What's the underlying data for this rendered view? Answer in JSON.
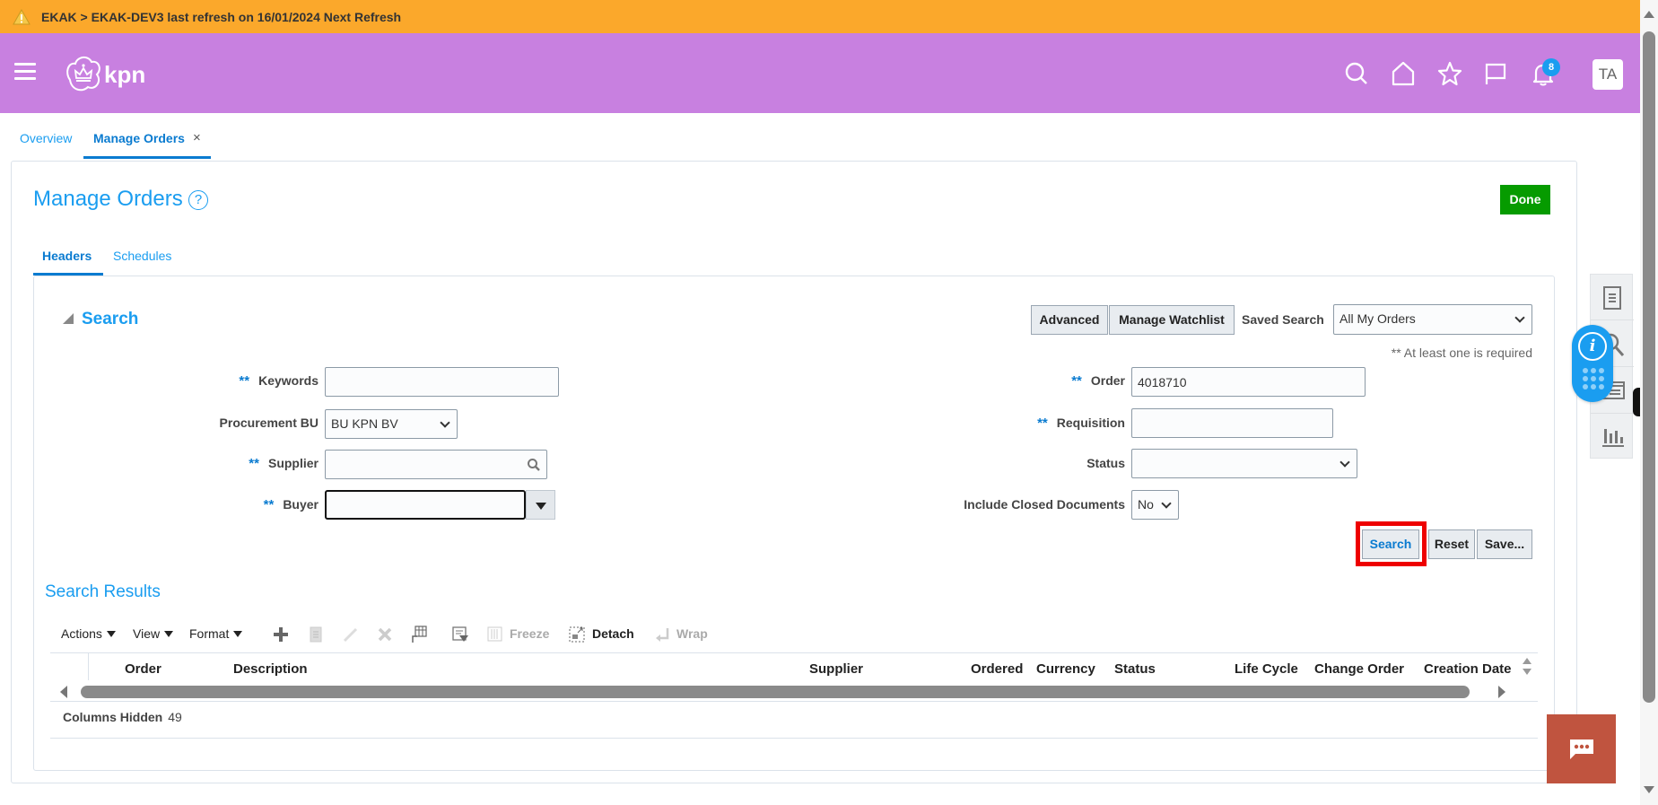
{
  "banner": {
    "icon": "warning-icon",
    "text": "EKAK > EKAK-DEV3 last refresh on 16/01/2024 Next Refresh"
  },
  "header": {
    "menu_icon": "hamburger-menu-icon",
    "logo_text": "kpn",
    "icons": [
      "search-icon",
      "home-icon",
      "star-icon",
      "flag-icon",
      "bell-icon"
    ],
    "notification_count": "8",
    "avatar_initials": "TA"
  },
  "tabs": [
    {
      "label": "Overview",
      "active": false
    },
    {
      "label": "Manage Orders",
      "active": true,
      "closable": true
    }
  ],
  "tab_close_glyph": "×",
  "page": {
    "title": "Manage Orders",
    "help_glyph": "?",
    "done_label": "Done"
  },
  "subtabs": [
    {
      "label": "Headers",
      "active": true
    },
    {
      "label": "Schedules",
      "active": false
    }
  ],
  "search": {
    "title": "Search",
    "advanced_label": "Advanced",
    "manage_watchlist_label": "Manage Watchlist",
    "saved_search_label": "Saved Search",
    "saved_search_value": "All My Orders",
    "required_note": "** At least one is required",
    "required_marker": "**",
    "fields_left": {
      "keywords": {
        "label": "Keywords",
        "value": ""
      },
      "procurement_bu": {
        "label": "Procurement BU",
        "value": "BU KPN BV"
      },
      "supplier": {
        "label": "Supplier",
        "value": ""
      },
      "buyer": {
        "label": "Buyer",
        "value": ""
      }
    },
    "fields_right": {
      "order": {
        "label": "Order",
        "value": "4018710"
      },
      "requisition": {
        "label": "Requisition",
        "value": ""
      },
      "status": {
        "label": "Status",
        "value": ""
      },
      "include_closed": {
        "label": "Include Closed Documents",
        "value": "No"
      }
    },
    "buttons": {
      "search": "Search",
      "reset": "Reset",
      "save": "Save..."
    }
  },
  "results": {
    "title": "Search Results",
    "menus": [
      "Actions",
      "View",
      "Format"
    ],
    "freeze_label": "Freeze",
    "detach_label": "Detach",
    "wrap_label": "Wrap",
    "columns": [
      "Order",
      "Description",
      "Supplier",
      "Ordered",
      "Currency",
      "Status",
      "Life Cycle",
      "Change Order",
      "Creation Date"
    ],
    "columns_hidden_label": "Columns Hidden",
    "columns_hidden_count": "49"
  },
  "colors": {
    "banner": "#fba82b",
    "header": "#c880e0",
    "accent": "#1a9df0",
    "done": "#069b00",
    "chat": "#c0543f",
    "focus_highlight": "#ee0000"
  }
}
